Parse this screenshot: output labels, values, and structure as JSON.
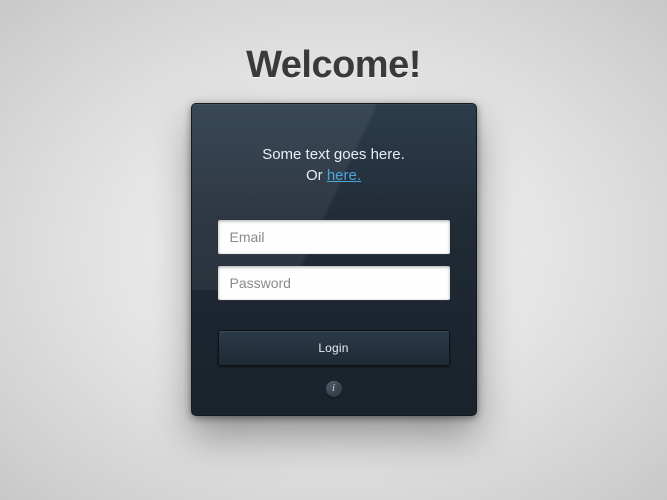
{
  "title": "Welcome!",
  "intro": {
    "line1": "Some text goes here.",
    "line2_prefix": "Or ",
    "line2_link": "here."
  },
  "form": {
    "email_placeholder": "Email",
    "password_placeholder": "Password",
    "login_label": "Login"
  },
  "info_glyph": "i"
}
